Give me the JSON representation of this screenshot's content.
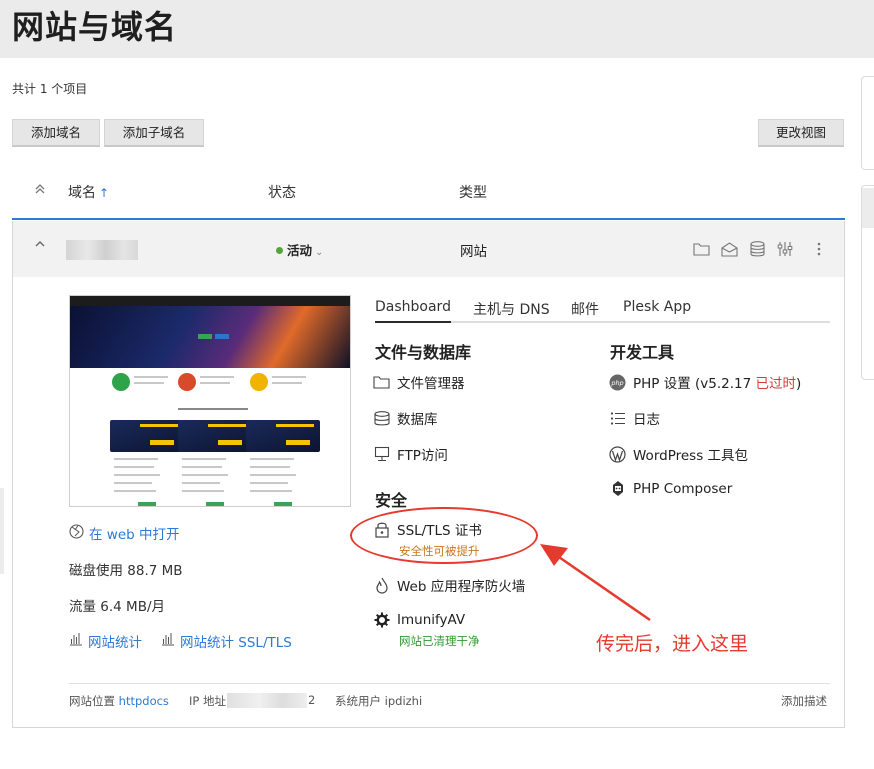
{
  "page": {
    "title": "网站与域名",
    "count_text": "共计 1 个项目"
  },
  "toolbar": {
    "add_domain": "添加域名",
    "add_subdomain": "添加子域名",
    "change_view": "更改视图"
  },
  "table": {
    "col_name": "域名",
    "sort_arrow": "↑",
    "col_status": "状态",
    "col_type": "类型"
  },
  "row": {
    "status": "活动",
    "type": "网站"
  },
  "sidebar": {
    "open_web": "在 web 中打开",
    "disk_usage": "磁盘使用 88.7 MB",
    "traffic": "流量 6.4 MB/月",
    "stats": "网站统计",
    "stats_ssl": "网站统计 SSL/TLS"
  },
  "tabs": [
    "Dashboard",
    "主机与 DNS",
    "邮件",
    "Plesk App"
  ],
  "files_section": {
    "title": "文件与数据库",
    "items": [
      "文件管理器",
      "数据库",
      "FTP访问"
    ]
  },
  "dev_section": {
    "title": "开发工具",
    "php_label": "PHP 设置 (v5.2.17 ",
    "php_outdated": "已过时",
    "php_close": ")",
    "logs": "日志",
    "wordpress": "WordPress 工具包",
    "composer": "PHP Composer"
  },
  "security_section": {
    "title": "安全",
    "ssl": "SSL/TLS 证书",
    "ssl_note": "安全性可被提升",
    "waf": "Web 应用程序防火墙",
    "imunify": "ImunifyAV",
    "imunify_note": "网站已清理干净"
  },
  "footer": {
    "location_label": "网站位置",
    "location_value": "httpdocs",
    "ip_label": "IP 地址",
    "ip_tail": "2",
    "sys_user": "系统用户 ipdizhi",
    "add_desc": "添加描述"
  },
  "annotation": {
    "text": "传完后，进入这里"
  },
  "colors": {
    "accent": "#2d7ad6",
    "alert": "#e53a2e",
    "active": "#57a33a",
    "outdated": "#d63b3b"
  }
}
